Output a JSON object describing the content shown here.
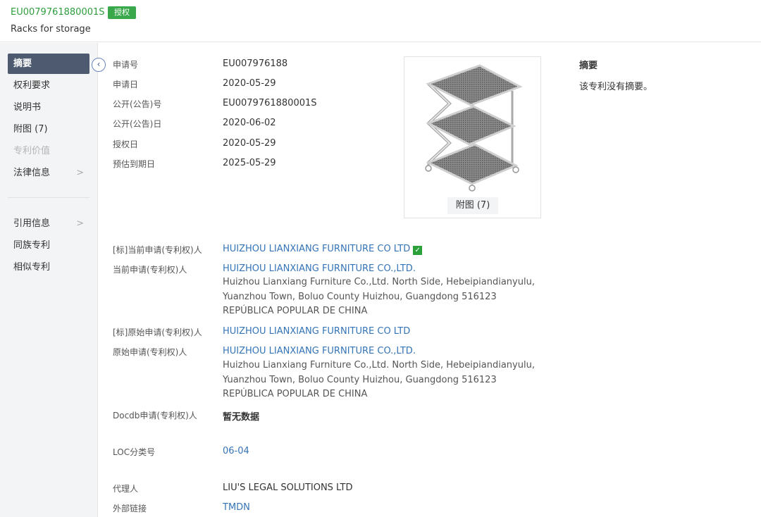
{
  "header": {
    "publication_number": "EU0079761880001S",
    "status_badge": "授权",
    "title": "Racks for storage"
  },
  "sidebar": {
    "items": [
      {
        "label": "摘要",
        "state": "active"
      },
      {
        "label": "权利要求"
      },
      {
        "label": "说明书"
      },
      {
        "label": "附图 (7)"
      },
      {
        "label": "专利价值",
        "state": "disabled"
      },
      {
        "label": "法律信息",
        "arrow": ">"
      },
      {
        "label": "引用信息",
        "arrow": ">"
      },
      {
        "label": "同族专利"
      },
      {
        "label": "相似专利"
      }
    ],
    "collapse_icon": "chevron-left-icon"
  },
  "info": {
    "application_number_label": "申请号",
    "application_number": "EU007976188",
    "application_date_label": "申请日",
    "application_date": "2020-05-29",
    "publication_number_label": "公开(公告)号",
    "publication_number": "EU0079761880001S",
    "publication_date_label": "公开(公告)日",
    "publication_date": "2020-06-02",
    "grant_date_label": "授权日",
    "grant_date": "2020-05-29",
    "expiry_date_label": "预估到期日",
    "expiry_date": "2025-05-29",
    "std_current_applicant_label": "[标]当前申请(专利权)人",
    "std_current_applicant": "HUIZHOU LIANXIANG FURNITURE CO LTD",
    "current_applicant_label": "当前申请(专利权)人",
    "current_applicant": "HUIZHOU LIANXIANG FURNITURE CO.,LTD.",
    "current_applicant_address": "Huizhou Lianxiang Furniture Co.,Ltd. North Side, Hebeipiandianyulu, Yuanzhou Town, Boluo County Huizhou, Guangdong 516123 REPÚBLICA POPULAR DE CHINA",
    "std_original_applicant_label": "[标]原始申请(专利权)人",
    "std_original_applicant": "HUIZHOU LIANXIANG FURNITURE CO LTD",
    "original_applicant_label": "原始申请(专利权)人",
    "original_applicant": "HUIZHOU LIANXIANG FURNITURE CO.,LTD.",
    "original_applicant_address": "Huizhou Lianxiang Furniture Co.,Ltd. North Side, Hebeipiandianyulu, Yuanzhou Town, Boluo County Huizhou, Guangdong 516123 REPÚBLICA POPULAR DE CHINA",
    "docdb_applicant_label": "Docdb申请(专利权)人",
    "docdb_applicant": "暂无数据",
    "loc_class_label": "LOC分类号",
    "loc_class": "06-04",
    "agent_label": "代理人",
    "agent": "LIU'S LEGAL SOLUTIONS LTD",
    "external_link_label": "外部链接",
    "external_link": "TMDN"
  },
  "figure": {
    "button_label": "附图 (7)"
  },
  "abstract": {
    "title": "摘要",
    "text": "该专利没有摘要。"
  },
  "colors": {
    "accent_green": "#39a84a",
    "link_blue": "#3574b7",
    "sidebar_active": "#4d5a70"
  }
}
